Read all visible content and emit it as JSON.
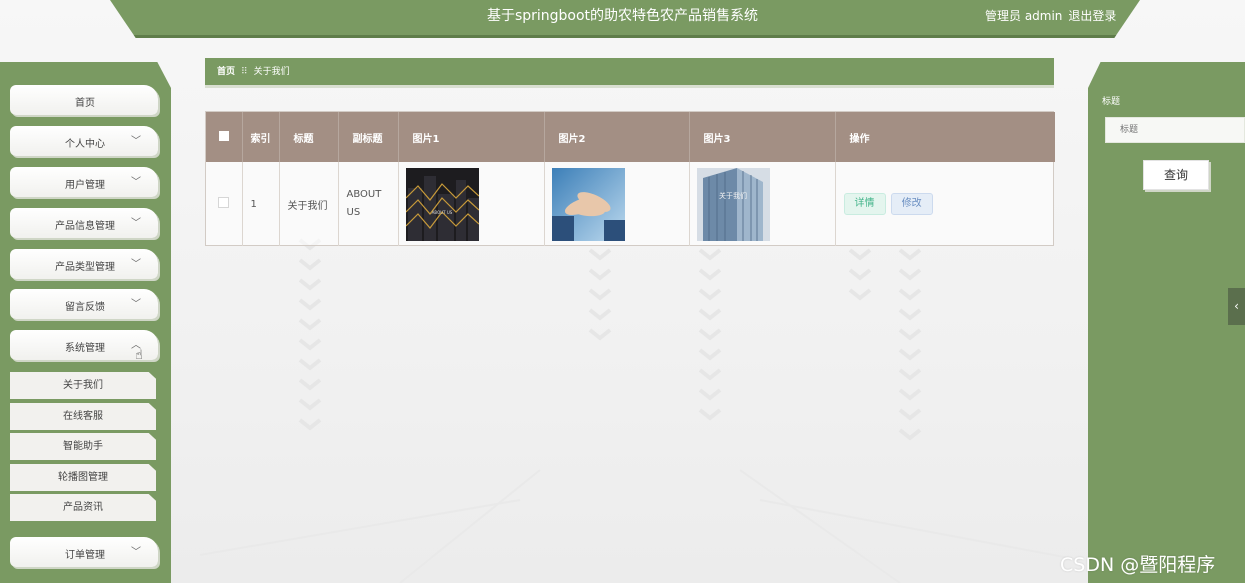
{
  "header": {
    "title": "基于springboot的助农特色农产品销售系统",
    "user_label": "管理员 admin",
    "logout_label": "退出登录"
  },
  "sidebar": {
    "items": [
      {
        "label": "首页",
        "chevron": ""
      },
      {
        "label": "个人中心",
        "chevron": "﹀"
      },
      {
        "label": "用户管理",
        "chevron": "﹀"
      },
      {
        "label": "产品信息管理",
        "chevron": "﹀"
      },
      {
        "label": "产品类型管理",
        "chevron": "﹀"
      },
      {
        "label": "留言反馈",
        "chevron": "﹀"
      },
      {
        "label": "系统管理",
        "chevron": "︿"
      },
      {
        "label": "订单管理",
        "chevron": "﹀"
      }
    ],
    "sub_items": [
      {
        "label": "关于我们"
      },
      {
        "label": "在线客服"
      },
      {
        "label": "智能助手"
      },
      {
        "label": "轮播图管理"
      },
      {
        "label": "产品资讯"
      }
    ]
  },
  "breadcrumb": {
    "home": "首页",
    "separator": "⠿",
    "current": "关于我们"
  },
  "table": {
    "headers": {
      "index": "索引",
      "title": "标题",
      "subtitle": "副标题",
      "picture1": "图片1",
      "picture2": "图片2",
      "picture3": "图片3",
      "actions": "操作"
    },
    "rows": [
      {
        "index": "1",
        "title": "关于我们",
        "subtitle": "ABOUT US",
        "picture1_icon": "dark-city-building-image",
        "picture1_text": "ABOUT US",
        "picture2_icon": "stacked-hands-teamwork-image",
        "picture3_icon": "glass-office-tower-image",
        "picture3_text": "关于我们",
        "detail_label": "详情",
        "edit_label": "修改"
      }
    ]
  },
  "search": {
    "label": "标题",
    "placeholder": "标题",
    "button_label": "查询"
  },
  "collapse_tab": {
    "icon": "chevron-left-icon",
    "glyph": "‹"
  },
  "watermark": "CSDN @暨阳程序",
  "colors": {
    "primary_green": "#7a9a62",
    "table_header": "#a38f84",
    "detail_button": "#43b48a",
    "edit_button": "#6b8fc2"
  }
}
